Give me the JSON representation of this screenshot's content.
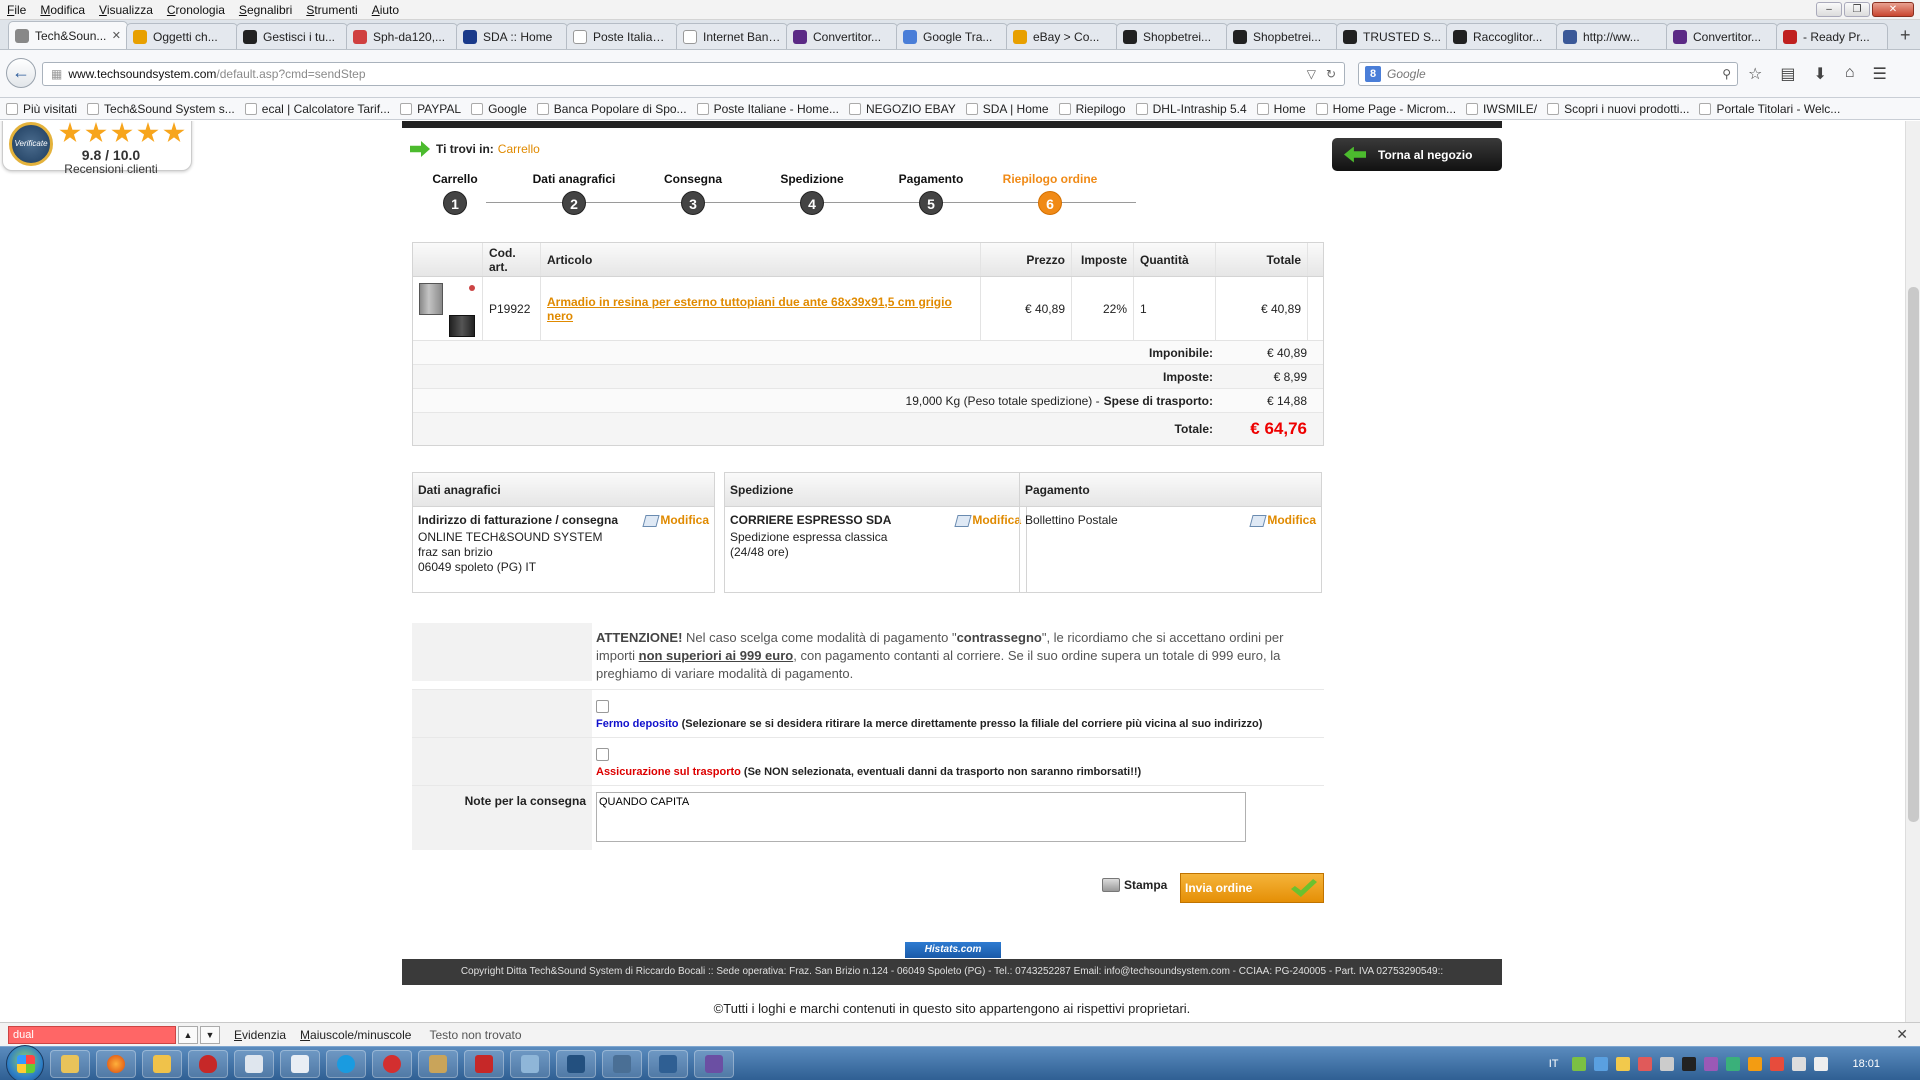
{
  "menu": [
    "File",
    "Modifica",
    "Visualizza",
    "Cronologia",
    "Segnalibri",
    "Strumenti",
    "Aiuto"
  ],
  "tabs": [
    {
      "label": "Tech&Soun...",
      "color": "#888888",
      "active": true
    },
    {
      "label": "Oggetti ch...",
      "color": "#e8a000"
    },
    {
      "label": "Gestisci i tu...",
      "color": "#222222"
    },
    {
      "label": "Sph-da120,...",
      "color": "#d04040"
    },
    {
      "label": "SDA :: Home",
      "color": "#1a3a8a"
    },
    {
      "label": "Poste Italiane - ...",
      "color": "#ffffff"
    },
    {
      "label": "Internet Banking",
      "color": "#ffffff"
    },
    {
      "label": "Convertitor...",
      "color": "#5b2a86"
    },
    {
      "label": "Google Tra...",
      "color": "#4a7ed8"
    },
    {
      "label": "eBay > Co...",
      "color": "#e8a000"
    },
    {
      "label": "Shopbetrei...",
      "color": "#222222"
    },
    {
      "label": "Shopbetrei...",
      "color": "#222222"
    },
    {
      "label": "TRUSTED S...",
      "color": "#222222"
    },
    {
      "label": "Raccoglitor...",
      "color": "#222222"
    },
    {
      "label": "http://ww...",
      "color": "#3b5998"
    },
    {
      "label": "Convertitor...",
      "color": "#5b2a86"
    },
    {
      "label": "- Ready Pr...",
      "color": "#c02020"
    }
  ],
  "url": {
    "host": "www.techsoundsystem.com",
    "path": "/default.asp?cmd=sendStep"
  },
  "search_placeholder": "Google",
  "bookmarks": [
    "Più visitati",
    "Tech&Sound System s...",
    "ecal | Calcolatore Tarif...",
    "PAYPAL",
    "Google",
    "Banca Popolare di Spo...",
    "Poste Italiane - Home...",
    "NEGOZIO EBAY",
    "SDA | Home",
    "Riepilogo",
    "DHL-Intraship 5.4",
    "Home",
    "Home Page - Microm...",
    "IWSMILE/",
    "Scopri i nuovi prodotti...",
    "Portale Titolari - Welc..."
  ],
  "cert": {
    "seal_text": "Verificate",
    "score": "9.8 / 10.0",
    "reviews": "Recensioni clienti"
  },
  "breadcrumb": {
    "label": "Ti trovi in:",
    "link": "Carrello"
  },
  "back_to_shop": "Torna al negozio",
  "steps": [
    {
      "label": "Carrello",
      "num": "1"
    },
    {
      "label": "Dati anagrafici",
      "num": "2"
    },
    {
      "label": "Consegna",
      "num": "3"
    },
    {
      "label": "Spedizione",
      "num": "4"
    },
    {
      "label": "Pagamento",
      "num": "5"
    },
    {
      "label": "Riepilogo ordine",
      "num": "6",
      "active": true
    }
  ],
  "table": {
    "headers": {
      "cod": "Cod. art.",
      "art": "Articolo",
      "prz": "Prezzo",
      "imp": "Imposte",
      "qty": "Quantità",
      "tot": "Totale"
    },
    "row": {
      "cod": "P19922",
      "art": "Armadio in resina per esterno tuttopiani due ante 68x39x91,5 cm grigio nero",
      "prz": "€ 40,89",
      "imp": "22%",
      "qty": "1",
      "tot": "€ 40,89"
    },
    "imponibile_label": "Imponibile:",
    "imponibile": "€ 40,89",
    "imposte_label": "Imposte:",
    "imposte": "€ 8,99",
    "weight": "19,000 Kg (Peso totale spedizione) -",
    "spese_label": "Spese di trasporto:",
    "spese": "€ 14,88",
    "totale_label": "Totale:",
    "totale": "€ 64,76"
  },
  "boxes": {
    "anag": {
      "head": "Dati anagrafici",
      "title": "Indirizzo di fatturazione / consegna",
      "lines": [
        "ONLINE TECH&SOUND SYSTEM",
        "fraz san brizio",
        "06049 spoleto (PG) IT"
      ],
      "edit": "Modifica"
    },
    "sped": {
      "head": "Spedizione",
      "title": "CORRIERE ESPRESSO SDA",
      "lines": [
        "Spedizione espressa classica",
        "(24/48 ore)"
      ],
      "edit": "Modifica"
    },
    "pag": {
      "head": "Pagamento",
      "lines": [
        "Bollettino Postale"
      ],
      "edit": "Modifica"
    }
  },
  "attention": {
    "a1": "ATTENZIONE!",
    "a2": " Nel caso scelga come modalità di pagamento \"",
    "a3": "contrassegno",
    "a4": "\", le ricordiamo che si accettano ordini per importi ",
    "a5": "non superiori ai 999 euro",
    "a6": ", con pagamento contanti al corriere. Se il suo ordine supera un totale di 999 euro, la preghiamo di variare modalità di pagamento."
  },
  "fermo": {
    "title": "Fermo deposito",
    "desc": " (Selezionare se si desidera ritirare la merce direttamente presso la filiale del corriere più vicina al suo indirizzo)"
  },
  "assic": {
    "title": "Assicurazione sul trasporto",
    "desc": " (Se NON selezionata, eventuali danni da trasporto non saranno rimborsati!!)"
  },
  "note": {
    "label": "Note per la consegna",
    "value": "QUANDO CAPITA"
  },
  "print_label": "Stampa",
  "send_label": "Invia ordine",
  "histats": "Histats.com",
  "footer": "Copyright Ditta Tech&Sound System di Riccardo Bocali :: Sede operativa: Fraz. San Brizio n.124 - 06049 Spoleto (PG) - Tel.: 0743252287 Email: info@techsoundsystem.com - CCIAA: PG-240005 - Part. IVA 02753290549::",
  "rights": "©Tutti i loghi e marchi contenuti in questo sito appartengono ai rispettivi proprietari.",
  "findbar": {
    "value": "dual",
    "opt1": "Evidenzia",
    "opt2": "Maiuscole/minuscole",
    "status": "Testo non trovato"
  },
  "tray": {
    "lang": "IT",
    "clock": "18:01"
  }
}
